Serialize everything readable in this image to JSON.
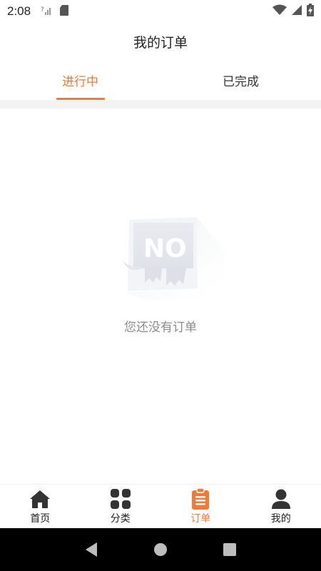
{
  "status_bar": {
    "time": "2:08",
    "icons_left": [
      "signal-question-icon",
      "sd-card-icon"
    ],
    "icons_right": [
      "wifi-icon",
      "cell-signal-icon",
      "battery-charging-icon"
    ]
  },
  "header": {
    "title": "我的订单"
  },
  "tabs": [
    {
      "label": "进行中",
      "active": true
    },
    {
      "label": "已完成",
      "active": false
    }
  ],
  "empty_state": {
    "illustration_text": "NO",
    "message": "您还没有订单"
  },
  "bottom_nav": {
    "items": [
      {
        "label": "首页",
        "icon": "home-icon",
        "active": false
      },
      {
        "label": "分类",
        "icon": "grid-icon",
        "active": false
      },
      {
        "label": "订单",
        "icon": "clipboard-icon",
        "active": true
      },
      {
        "label": "我的",
        "icon": "user-icon",
        "active": false
      }
    ]
  },
  "colors": {
    "accent": "#f07a36",
    "text": "#222222",
    "muted": "#8b8b8b",
    "band": "#f3f3f3"
  }
}
